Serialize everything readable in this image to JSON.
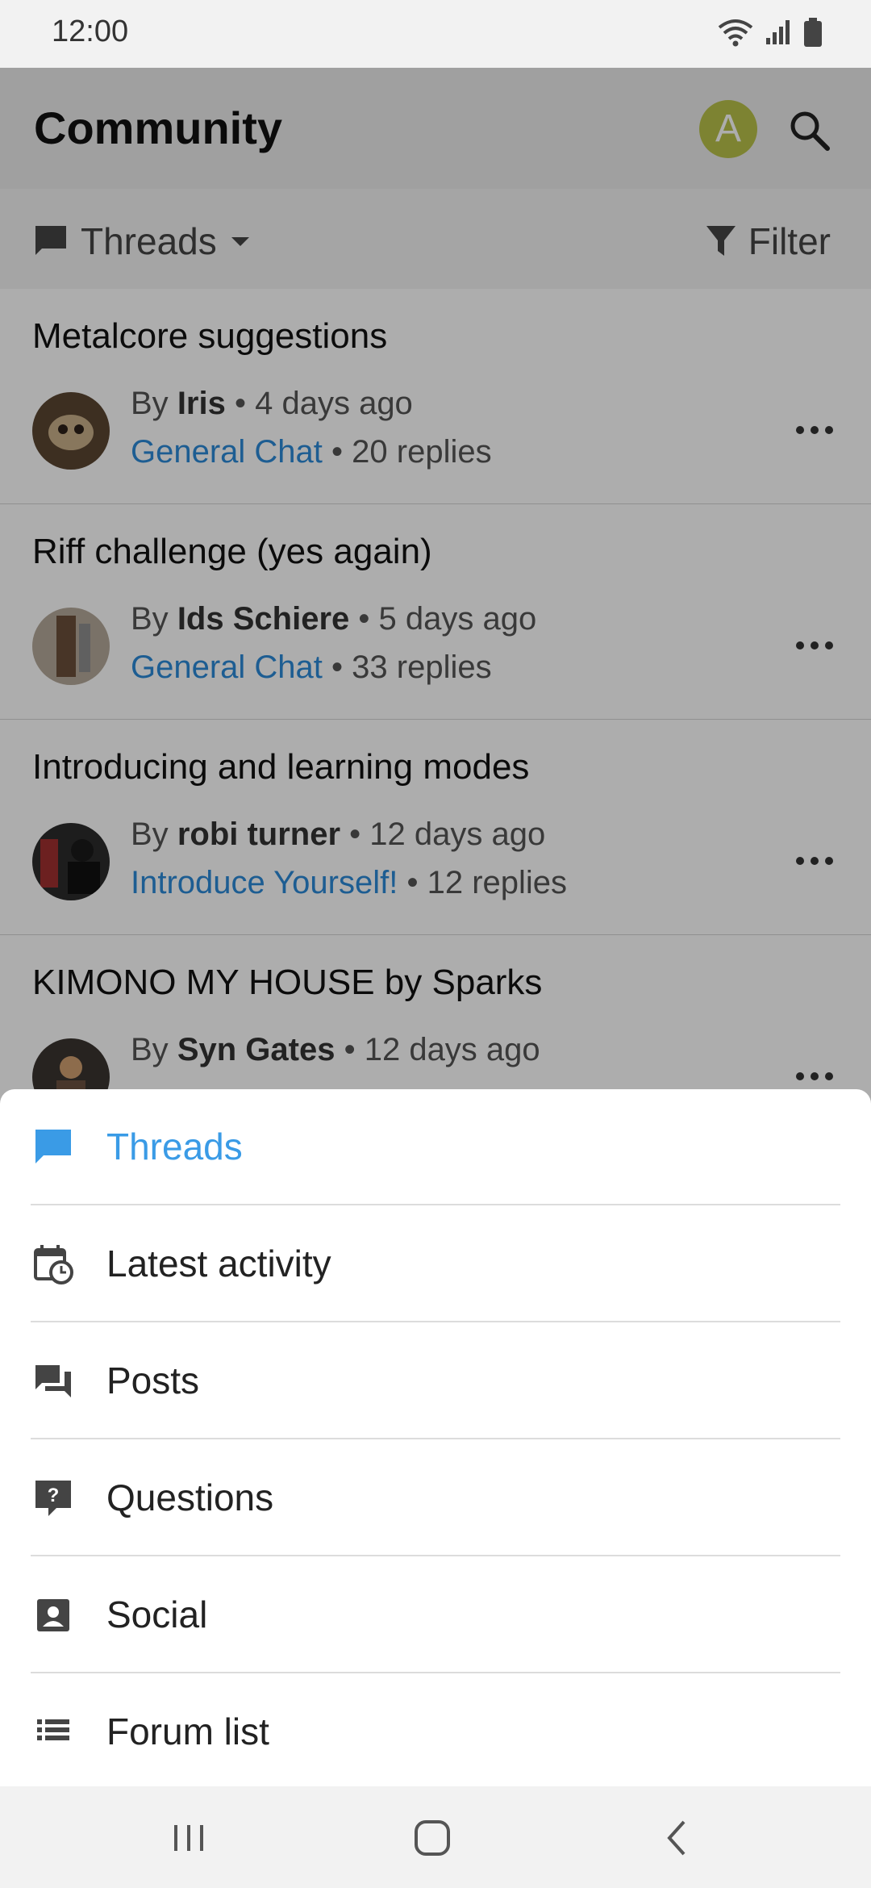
{
  "status_bar": {
    "time": "12:00"
  },
  "app_bar": {
    "title": "Community",
    "avatar_letter": "A"
  },
  "filter_bar": {
    "view_label": "Threads",
    "filter_label": "Filter"
  },
  "threads": [
    {
      "title": "Metalcore suggestions",
      "by": "By",
      "author": "Iris",
      "age": "• 4 days ago",
      "forum": "General Chat",
      "replies": "• 20 replies"
    },
    {
      "title": "Riff challenge (yes again)",
      "by": "By",
      "author": "Ids Schiere",
      "age": "• 5 days ago",
      "forum": "General Chat",
      "replies": "• 33 replies"
    },
    {
      "title": "Introducing and learning modes",
      "by": "By",
      "author": "robi turner",
      "age": "• 12 days ago",
      "forum": "Introduce Yourself!",
      "replies": "• 12 replies"
    },
    {
      "title": "KIMONO MY HOUSE by Sparks",
      "by": "By",
      "author": "Syn Gates",
      "age": "• 12 days ago",
      "forum": "",
      "replies": ""
    }
  ],
  "menu": {
    "items": [
      {
        "label": "Threads",
        "icon": "chat-bubble-icon",
        "active": true
      },
      {
        "label": "Latest activity",
        "icon": "calendar-clock-icon",
        "active": false
      },
      {
        "label": "Posts",
        "icon": "forum-icon",
        "active": false
      },
      {
        "label": "Questions",
        "icon": "question-bubble-icon",
        "active": false
      },
      {
        "label": "Social",
        "icon": "contact-card-icon",
        "active": false
      },
      {
        "label": "Forum list",
        "icon": "list-icon",
        "active": false
      }
    ]
  },
  "colors": {
    "accent": "#3a9be6",
    "forum_link": "#2b8ad8",
    "avatar_bg": "#b9c24a"
  }
}
